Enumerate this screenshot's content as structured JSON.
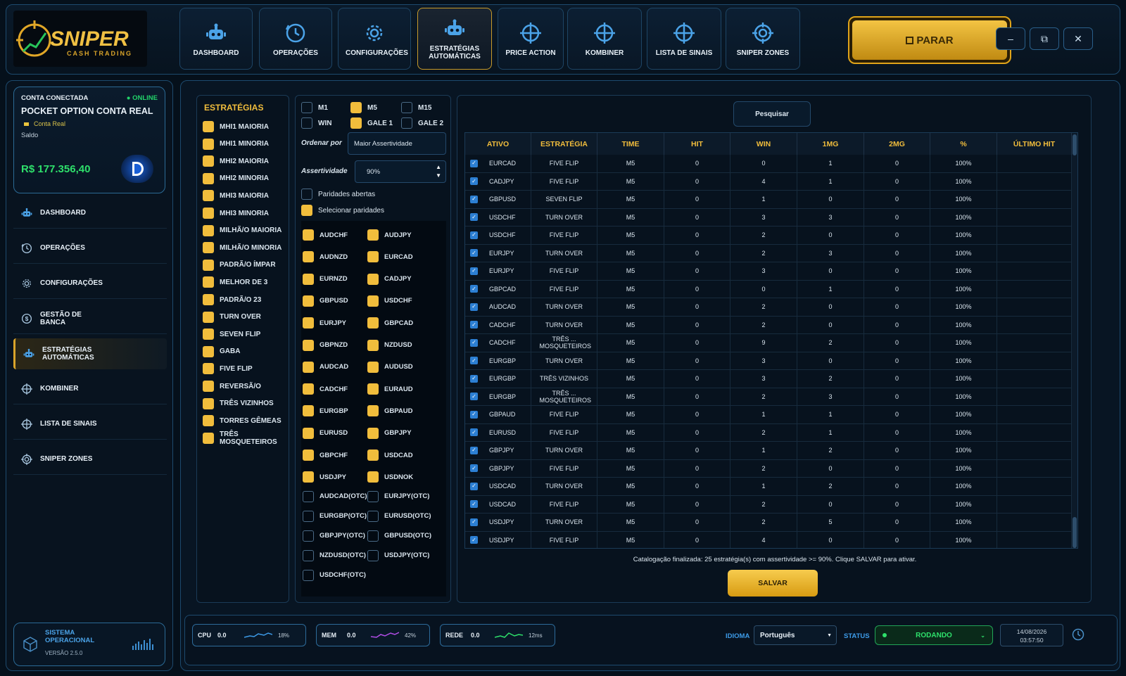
{
  "logo": {
    "title": "SNIPER",
    "subtitle": "CASH TRADING"
  },
  "nav": [
    {
      "label": "DASHBOARD",
      "icon": "robot-icon"
    },
    {
      "label": "OPERAÇÕES",
      "icon": "clock-icon"
    },
    {
      "label": "CONFIGURAÇÕES",
      "icon": "gear-icon"
    },
    {
      "label": "ESTRATÉGIAS AUTOMÁTICAS",
      "icon": "robot-icon",
      "active": true
    },
    {
      "label": "PRICE ACTION",
      "icon": "crosshair-icon"
    },
    {
      "label": "KOMBINER",
      "icon": "crosshair-icon"
    },
    {
      "label": "LISTA DE SINAIS",
      "icon": "crosshair-icon"
    },
    {
      "label": "SNIPER ZONES",
      "icon": "target-icon"
    }
  ],
  "stop_button": "PARAR",
  "window_controls": {
    "minimize": "–",
    "restore": "⧉",
    "close": "✕"
  },
  "account": {
    "header": "CONTA CONECTADA",
    "status": "● ONLINE",
    "name": "POCKET OPTION CONTA REAL",
    "type": "Conta Real",
    "balance_label": "Saldo",
    "balance": "R$ 177.356,40"
  },
  "sidebar": [
    {
      "label": "DASHBOARD",
      "icon": "robot-icon"
    },
    {
      "label": "OPERAÇÕES",
      "icon": "clock-icon"
    },
    {
      "label": "CONFIGURAÇÕES",
      "icon": "gear-icon"
    },
    {
      "label": "GESTÃO DE BANCA",
      "icon": "dollar-icon"
    },
    {
      "label": "ESTRATÉGIAS AUTOMÁTICAS",
      "icon": "robot-icon",
      "active": true
    },
    {
      "label": "KOMBINER",
      "icon": "crosshair-icon"
    },
    {
      "label": "LISTA DE SINAIS",
      "icon": "crosshair-icon"
    },
    {
      "label": "SNIPER ZONES",
      "icon": "target-icon"
    }
  ],
  "system": {
    "title": "SISTEMA OPERACIONAL",
    "version": "VERSÃO 2.5.0"
  },
  "strategies": {
    "title": "ESTRATÉGIAS",
    "items": [
      "MHI1 MAIORIA",
      "MHI1 MINORIA",
      "MHI2 MAIORIA",
      "MHI2 MINORIA",
      "MHI3 MAIORIA",
      "MHI3 MINORIA",
      "MILHÃ/O MAIORIA",
      "MILHÃ/O MINORIA",
      "PADRÃ/O ÍMPAR",
      "MELHOR DE 3",
      "PADRÃ/O 23",
      "TURN OVER",
      "SEVEN FLIP",
      "GABA",
      "FIVE FLIP",
      "REVERSÃ/O",
      "TRÊS VIZINHOS",
      "TORRES GÊMEAS",
      "TRÊS MOSQUETEIROS"
    ]
  },
  "filters": {
    "timeframes": [
      {
        "label": "M1",
        "checked": false
      },
      {
        "label": "M5",
        "checked": true
      },
      {
        "label": "M15",
        "checked": false
      },
      {
        "label": "WIN",
        "checked": false
      },
      {
        "label": "GALE 1",
        "checked": true
      },
      {
        "label": "GALE 2",
        "checked": false
      }
    ],
    "order_label": "Ordenar por",
    "order_value": "Maior Assertividade",
    "assert_label": "Assertividade",
    "assert_value": "90%",
    "open_pairs": "Paridades abertas",
    "select_pairs": "Selecionar paridades",
    "pairs": [
      {
        "name": "AUDCHF",
        "checked": true
      },
      {
        "name": "AUDJPY",
        "checked": true
      },
      {
        "name": "AUDNZD",
        "checked": true
      },
      {
        "name": "EURCAD",
        "checked": true
      },
      {
        "name": "EURNZD",
        "checked": true
      },
      {
        "name": "CADJPY",
        "checked": true
      },
      {
        "name": "GBPUSD",
        "checked": true
      },
      {
        "name": "USDCHF",
        "checked": true
      },
      {
        "name": "EURJPY",
        "checked": true
      },
      {
        "name": "GBPCAD",
        "checked": true
      },
      {
        "name": "GBPNZD",
        "checked": true
      },
      {
        "name": "NZDUSD",
        "checked": true
      },
      {
        "name": "AUDCAD",
        "checked": true
      },
      {
        "name": "AUDUSD",
        "checked": true
      },
      {
        "name": "CADCHF",
        "checked": true
      },
      {
        "name": "EURAUD",
        "checked": true
      },
      {
        "name": "EURGBP",
        "checked": true
      },
      {
        "name": "GBPAUD",
        "checked": true
      },
      {
        "name": "EURUSD",
        "checked": true
      },
      {
        "name": "GBPJPY",
        "checked": true
      },
      {
        "name": "GBPCHF",
        "checked": true
      },
      {
        "name": "USDCAD",
        "checked": true
      },
      {
        "name": "USDJPY",
        "checked": true
      },
      {
        "name": "USDNOK",
        "checked": true
      },
      {
        "name": "AUDCAD(OTC)",
        "checked": false
      },
      {
        "name": "EURJPY(OTC)",
        "checked": false
      },
      {
        "name": "EURGBP(OTC)",
        "checked": false
      },
      {
        "name": "EURUSD(OTC)",
        "checked": false
      },
      {
        "name": "GBPJPY(OTC)",
        "checked": false
      },
      {
        "name": "GBPUSD(OTC)",
        "checked": false
      },
      {
        "name": "NZDUSD(OTC)",
        "checked": false
      },
      {
        "name": "USDJPY(OTC)",
        "checked": false
      },
      {
        "name": "USDCHF(OTC)",
        "checked": false
      }
    ]
  },
  "search_button": "Pesquisar",
  "table": {
    "headers": [
      "ATIVO",
      "ESTRATÉGIA",
      "TIME",
      "HIT",
      "WIN",
      "1MG",
      "2MG",
      "%",
      "ÚLTIMO HIT"
    ],
    "rows": [
      [
        "EURCAD",
        "FIVE FLIP",
        "M5",
        "0",
        "0",
        "1",
        "0",
        "100%",
        ""
      ],
      [
        "CADJPY",
        "FIVE FLIP",
        "M5",
        "0",
        "4",
        "1",
        "0",
        "100%",
        ""
      ],
      [
        "GBPUSD",
        "SEVEN FLIP",
        "M5",
        "0",
        "1",
        "0",
        "0",
        "100%",
        ""
      ],
      [
        "USDCHF",
        "TURN OVER",
        "M5",
        "0",
        "3",
        "3",
        "0",
        "100%",
        ""
      ],
      [
        "USDCHF",
        "FIVE FLIP",
        "M5",
        "0",
        "2",
        "0",
        "0",
        "100%",
        ""
      ],
      [
        "EURJPY",
        "TURN OVER",
        "M5",
        "0",
        "2",
        "3",
        "0",
        "100%",
        ""
      ],
      [
        "EURJPY",
        "FIVE FLIP",
        "M5",
        "0",
        "3",
        "0",
        "0",
        "100%",
        ""
      ],
      [
        "GBPCAD",
        "FIVE FLIP",
        "M5",
        "0",
        "0",
        "1",
        "0",
        "100%",
        ""
      ],
      [
        "AUDCAD",
        "TURN OVER",
        "M5",
        "0",
        "2",
        "0",
        "0",
        "100%",
        ""
      ],
      [
        "CADCHF",
        "TURN OVER",
        "M5",
        "0",
        "2",
        "0",
        "0",
        "100%",
        ""
      ],
      [
        "CADCHF",
        "TRÊS ... MOSQUETEIROS",
        "M5",
        "0",
        "9",
        "2",
        "0",
        "100%",
        ""
      ],
      [
        "EURGBP",
        "TURN OVER",
        "M5",
        "0",
        "3",
        "0",
        "0",
        "100%",
        ""
      ],
      [
        "EURGBP",
        "TRÊS VIZINHOS",
        "M5",
        "0",
        "3",
        "2",
        "0",
        "100%",
        ""
      ],
      [
        "EURGBP",
        "TRÊS ... MOSQUETEIROS",
        "M5",
        "0",
        "2",
        "3",
        "0",
        "100%",
        ""
      ],
      [
        "GBPAUD",
        "FIVE FLIP",
        "M5",
        "0",
        "1",
        "1",
        "0",
        "100%",
        ""
      ],
      [
        "EURUSD",
        "FIVE FLIP",
        "M5",
        "0",
        "2",
        "1",
        "0",
        "100%",
        ""
      ],
      [
        "GBPJPY",
        "TURN OVER",
        "M5",
        "0",
        "1",
        "2",
        "0",
        "100%",
        ""
      ],
      [
        "GBPJPY",
        "FIVE FLIP",
        "M5",
        "0",
        "2",
        "0",
        "0",
        "100%",
        ""
      ],
      [
        "USDCAD",
        "TURN OVER",
        "M5",
        "0",
        "1",
        "2",
        "0",
        "100%",
        ""
      ],
      [
        "USDCAD",
        "FIVE FLIP",
        "M5",
        "0",
        "2",
        "0",
        "0",
        "100%",
        ""
      ],
      [
        "USDJPY",
        "TURN OVER",
        "M5",
        "0",
        "2",
        "5",
        "0",
        "100%",
        ""
      ],
      [
        "USDJPY",
        "FIVE FLIP",
        "M5",
        "0",
        "4",
        "0",
        "0",
        "100%",
        ""
      ]
    ]
  },
  "status_message": "Catalogação finalizada: 25 estratégia(s) com assertividade >= 90%. Clique SALVAR para ativar.",
  "save_button": "SALVAR",
  "bottom": {
    "cpu": {
      "label": "CPU",
      "value": "0.0",
      "pct": "18%"
    },
    "mem": {
      "label": "MEM",
      "value": "0.0",
      "pct": "42%"
    },
    "net": {
      "label": "REDE",
      "value": "0.0",
      "pct": "12ms"
    },
    "lang_label": "IDIOMA",
    "lang_value": "Português",
    "status_label": "STATUS",
    "status_value": "RODANDO",
    "date": "14/08/2026",
    "time": "03:57:50"
  },
  "colors": {
    "accent": "#f1bd3c",
    "online": "#22d36a",
    "balance": "#2ee06b",
    "border": "#1d4a6e"
  }
}
